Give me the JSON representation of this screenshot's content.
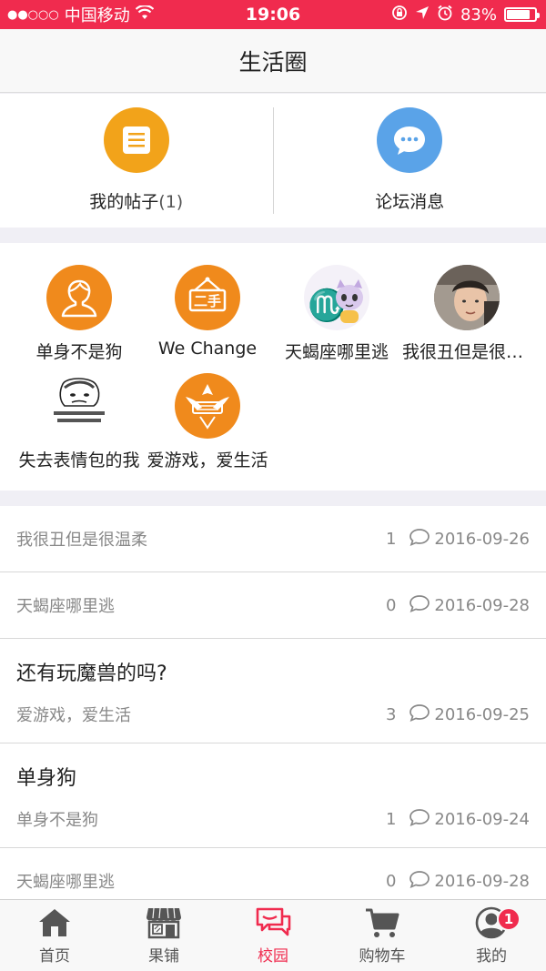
{
  "status_bar": {
    "carrier": "中国移动",
    "time": "19:06",
    "battery": "83%",
    "battery_level": 0.83
  },
  "header": {
    "title": "生活圈"
  },
  "quick": {
    "items": [
      {
        "label": "我的帖子",
        "count": "(1)",
        "icon": "document-icon",
        "color": "#f2a31a"
      },
      {
        "label": "论坛消息",
        "icon": "chat-bubble-icon",
        "color": "#5aa3e8"
      }
    ]
  },
  "circles": [
    {
      "name": "单身不是狗",
      "icon": "person-icon"
    },
    {
      "name": "We Change",
      "icon": "sign-icon"
    },
    {
      "name": "天蝎座哪里逃",
      "icon": "scorpio-cartoon-icon"
    },
    {
      "name": "我很丑但是很温柔",
      "icon": "photo-avatar"
    },
    {
      "name": "失去表情包的我",
      "icon": "meme-face-icon"
    },
    {
      "name": "爱游戏，爱生活",
      "icon": "game-emblem-icon"
    }
  ],
  "posts": [
    {
      "title": "",
      "author": "我很丑但是很温柔",
      "count": "1",
      "date": "2016-09-26"
    },
    {
      "title": "",
      "author": "天蝎座哪里逃",
      "count": "0",
      "date": "2016-09-28"
    },
    {
      "title": "还有玩魔兽的吗?",
      "author": "爱游戏，爱生活",
      "count": "3",
      "date": "2016-09-25"
    },
    {
      "title": "单身狗",
      "author": "单身不是狗",
      "count": "1",
      "date": "2016-09-24"
    },
    {
      "title": "",
      "author": "天蝎座哪里逃",
      "count": "0",
      "date": "2016-09-28"
    }
  ],
  "tabbar": {
    "tabs": [
      {
        "label": "首页",
        "icon": "home-icon"
      },
      {
        "label": "果铺",
        "icon": "store-icon"
      },
      {
        "label": "校园",
        "icon": "campus-chat-icon",
        "active": true
      },
      {
        "label": "购物车",
        "icon": "cart-icon"
      },
      {
        "label": "我的",
        "icon": "user-icon",
        "badge": "1"
      }
    ],
    "accent": "#f02b4e"
  }
}
